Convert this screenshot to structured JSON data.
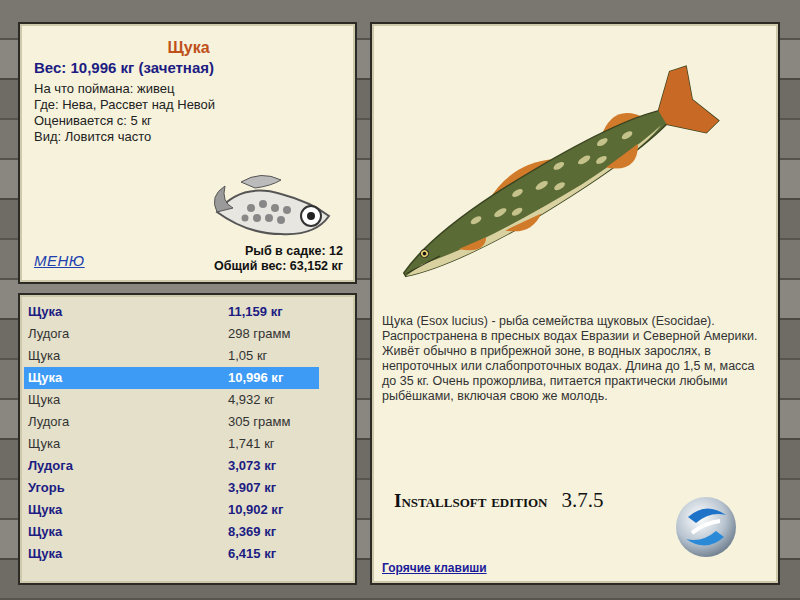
{
  "fish_card": {
    "title": "Щука",
    "weight": "Вес: 10,996 кг (зачетная)",
    "details": [
      "На что поймана: живец",
      "Где: Нева, Рассвет над Невой",
      "Оценивается с: 5 кг",
      "Вид: Ловится часто"
    ]
  },
  "menu": "МЕНЮ",
  "keepnet": {
    "count": "Рыб в садке: 12",
    "total": "Общий вес: 63,152 кг"
  },
  "catch_list": [
    {
      "name": "Щука",
      "weight": "11,159 кг",
      "trophy": true,
      "selected": false
    },
    {
      "name": "Лудога",
      "weight": "298 грамм",
      "trophy": false,
      "selected": false
    },
    {
      "name": "Щука",
      "weight": "1,05 кг",
      "trophy": false,
      "selected": false
    },
    {
      "name": "Щука",
      "weight": "10,996 кг",
      "trophy": true,
      "selected": true
    },
    {
      "name": "Щука",
      "weight": "4,932 кг",
      "trophy": false,
      "selected": false
    },
    {
      "name": "Лудога",
      "weight": "305 грамм",
      "trophy": false,
      "selected": false
    },
    {
      "name": "Щука",
      "weight": "1,741 кг",
      "trophy": false,
      "selected": false
    },
    {
      "name": "Лудога",
      "weight": "3,073 кг",
      "trophy": true,
      "selected": false
    },
    {
      "name": "Угорь",
      "weight": "3,907 кг",
      "trophy": true,
      "selected": false
    },
    {
      "name": "Щука",
      "weight": "10,902 кг",
      "trophy": true,
      "selected": false
    },
    {
      "name": "Щука",
      "weight": "8,369 кг",
      "trophy": true,
      "selected": false
    },
    {
      "name": "Щука",
      "weight": "6,415 кг",
      "trophy": true,
      "selected": false
    }
  ],
  "description": "Щука (Esox lucius) - рыба семейства щуковых (Esocidae). Распространена в пресных водах Евразии и Северной Америки. Живёт обычно в прибрежной зоне, в водных зарослях, в непроточных или слабопроточных водах. Длина до 1,5 м, масса до 35 кг. Очень прожорлива, питается практически любыми рыбёшками, включая свою же молодь.",
  "edition": {
    "name": "Installsoft edition",
    "version": "3.7.5"
  },
  "hotkeys_link": "Горячие клавиши"
}
